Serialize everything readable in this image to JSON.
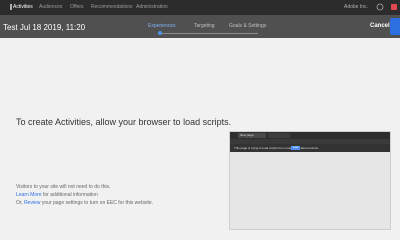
{
  "nav": {
    "items": [
      "Activities",
      "Audiences",
      "Offers",
      "Recommendations",
      "Administration"
    ],
    "environment": "Adobe Inc."
  },
  "header": {
    "title": "Test Jul 18 2019, 11:20",
    "steps": [
      "Experiences",
      "Targeting",
      "Goals & Settings"
    ],
    "cancel_label": "Cancel"
  },
  "message": {
    "heading": "To create Activities, allow your browser to load scripts.",
    "line1": "Visitors to your site will not need to do this.",
    "line2_link": "Learn More",
    "line2_rest": "for additional information",
    "line3_start": "Or,",
    "line3_link": "Review",
    "line3_rest": "your page settings to turn on EEC for this website."
  },
  "preview": {
    "tab_label": "New page",
    "bar_text": "This page is trying to load scripts from unauthenticated sources.",
    "button_label": "Load"
  },
  "colors": {
    "topnav": "#2c2c2c",
    "header": "#505050",
    "accent": "#2d6ee0",
    "content_bg": "#f1f1f1"
  }
}
